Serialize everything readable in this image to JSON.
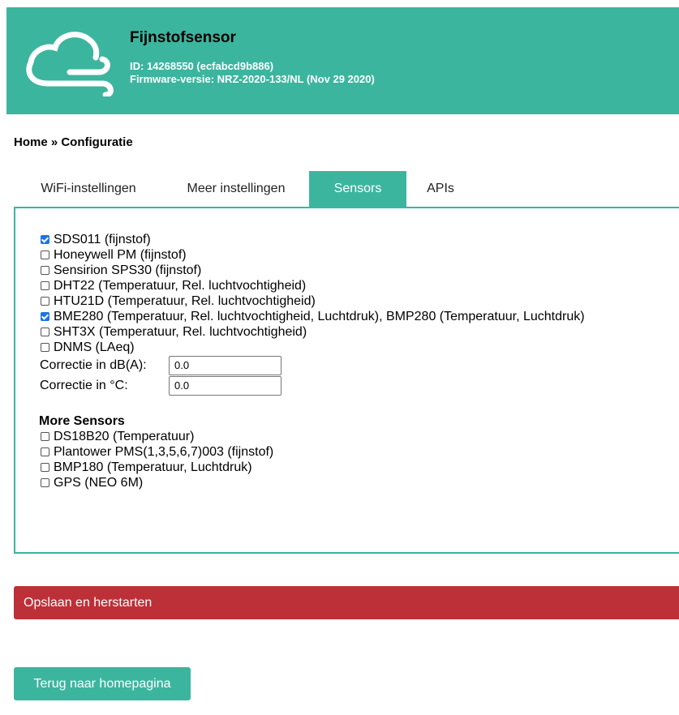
{
  "header": {
    "title": "Fijnstofsensor",
    "id_line": "ID: 14268550 (ecfabcd9b886)",
    "firmware_line": "Firmware-versie: NRZ-2020-133/NL (Nov 29 2020)",
    "logo_icon": "cloud-wind-icon",
    "color": "#3cb59f"
  },
  "breadcrumb": "Home » Configuratie",
  "tabs": [
    {
      "label": "WiFi-instellingen",
      "active": false
    },
    {
      "label": "Meer instellingen",
      "active": false
    },
    {
      "label": "Sensors",
      "active": true
    },
    {
      "label": "APIs",
      "active": false
    }
  ],
  "sensors": [
    {
      "label": "SDS011 (fijnstof)",
      "checked": true
    },
    {
      "label": "Honeywell PM (fijnstof)",
      "checked": false
    },
    {
      "label": "Sensirion SPS30 (fijnstof)",
      "checked": false
    },
    {
      "label": "DHT22 (Temperatuur, Rel. luchtvochtigheid)",
      "checked": false
    },
    {
      "label": "HTU21D (Temperatuur, Rel. luchtvochtigheid)",
      "checked": false
    },
    {
      "label": "BME280 (Temperatuur, Rel. luchtvochtigheid, Luchtdruk), BMP280 (Temperatuur, Luchtdruk)",
      "checked": true
    },
    {
      "label": "SHT3X (Temperatuur, Rel. luchtvochtigheid)",
      "checked": false
    },
    {
      "label": "DNMS (LAeq)",
      "checked": false
    }
  ],
  "fields": {
    "db_label": "Correctie in dB(A):",
    "db_value": "0.0",
    "temp_label": "Correctie in °C:",
    "temp_value": "0.0"
  },
  "more_sensors": {
    "title": "More Sensors",
    "items": [
      {
        "label": "DS18B20 (Temperatuur)",
        "checked": false
      },
      {
        "label": "Plantower PMS(1,3,5,6,7)003 (fijnstof)",
        "checked": false
      },
      {
        "label": "BMP180 (Temperatuur, Luchtdruk)",
        "checked": false
      },
      {
        "label": "GPS (NEO 6M)",
        "checked": false
      }
    ]
  },
  "buttons": {
    "save": "Opslaan en herstarten",
    "save_color": "#bd3037",
    "home": "Terug naar homepagina"
  }
}
